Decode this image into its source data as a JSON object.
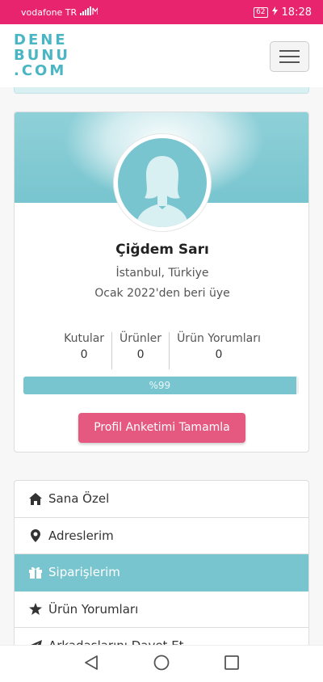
{
  "status_bar": {
    "carrier": "vodafone TR",
    "battery": "62",
    "time": "18:28"
  },
  "header": {
    "logo_lines": [
      "DENE",
      "BUNU",
      ".COM"
    ]
  },
  "profile": {
    "name": "Çiğdem Sarı",
    "location": "İstanbul, Türkiye",
    "member_since": "Ocak 2022'den beri üye",
    "stats": [
      {
        "label": "Kutular",
        "value": "0"
      },
      {
        "label": "Ürünler",
        "value": "0"
      },
      {
        "label": "Ürün Yorumları",
        "value": "0"
      }
    ],
    "progress_label": "%99",
    "progress_fraction": 0.99,
    "survey_button": "Profil Anketimi Tamamla"
  },
  "menu": [
    {
      "icon": "home-icon",
      "label": "Sana Özel"
    },
    {
      "icon": "map-marker-icon",
      "label": "Adreslerim"
    },
    {
      "icon": "gift-icon",
      "label": "Siparişlerim",
      "active": true
    },
    {
      "icon": "star-icon",
      "label": "Ürün Yorumları"
    },
    {
      "icon": "paper-plane-icon",
      "label": "Arkadaşlarını Davet Et"
    }
  ],
  "colors": {
    "status_bar": "#e8246f",
    "accent": "#78c5cf",
    "survey_button": "#e5587f"
  }
}
